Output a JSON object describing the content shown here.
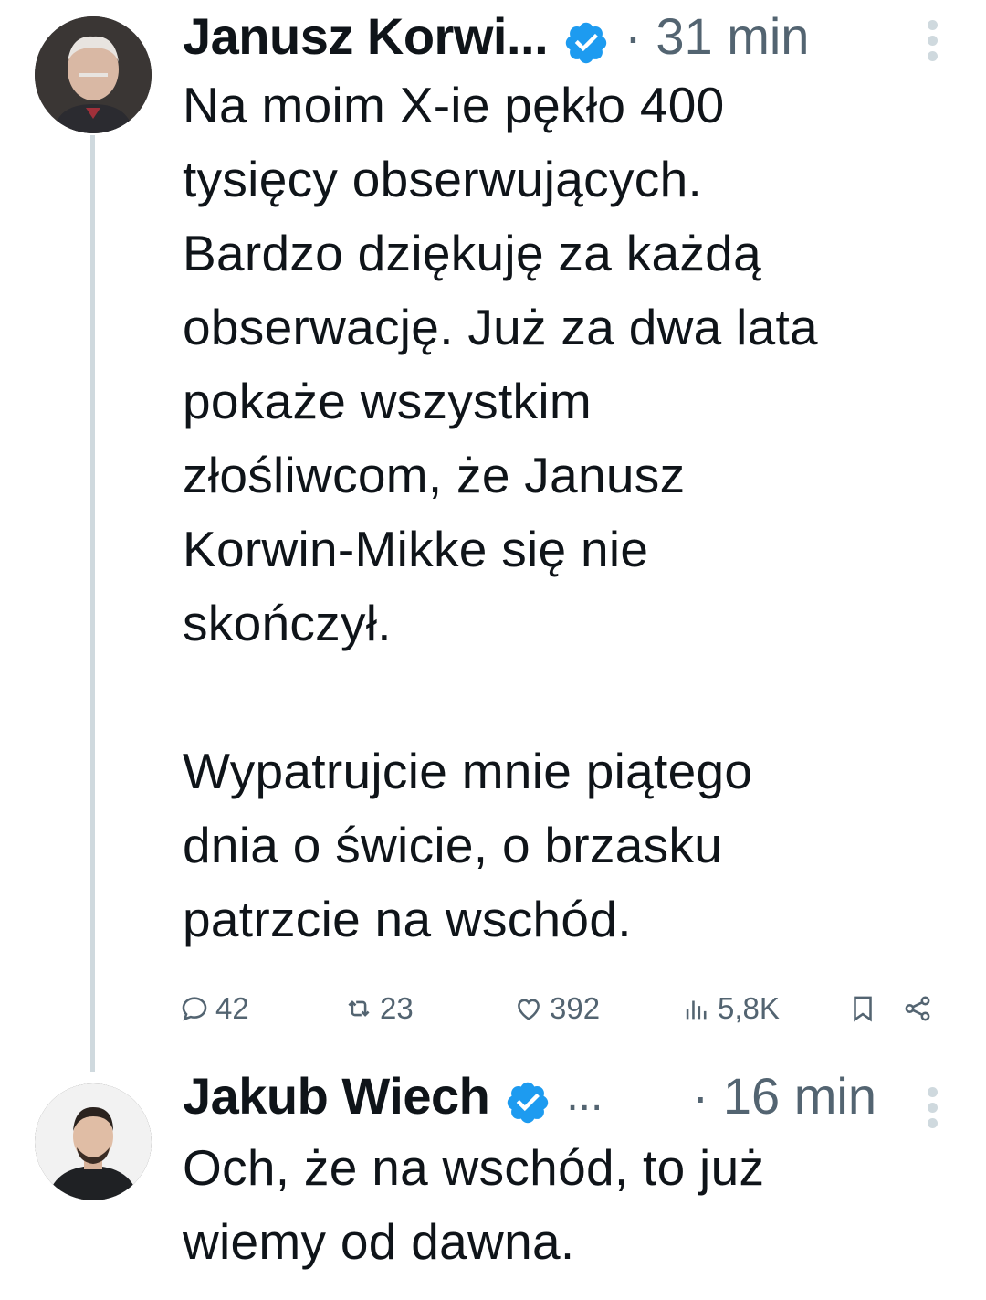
{
  "tweets": [
    {
      "author": "Janusz Korwi...",
      "time": "· 31 min",
      "text": "Na moim X-ie pękło 400\ntysięcy obserwujących.\nBardzo dziękuję za każdą\nobserwację. Już za dwa lata\npokaże wszystkim\nzłośliwcom, że Janusz\nKorwin-Mikke się nie\nskończył.\n\nWypatrujcie mnie piątego\ndnia o świcie, o brzasku\npatrzcie na wschód.",
      "stats": {
        "replies": "42",
        "reposts": "23",
        "likes": "392",
        "views": "5,8K"
      }
    },
    {
      "author": "Jakub Wiech",
      "ellipsis": "...",
      "time": "· 16 min",
      "text": "Och, że na wschód, to już\nwiemy od dawna."
    }
  ],
  "colors": {
    "verified": "#1d9bf0",
    "muted": "#536471",
    "thread_line": "#cfd9de"
  },
  "icons": [
    "verified-badge-icon",
    "more-icon",
    "reply-icon",
    "repost-icon",
    "like-icon",
    "views-icon",
    "bookmark-icon",
    "share-icon"
  ]
}
